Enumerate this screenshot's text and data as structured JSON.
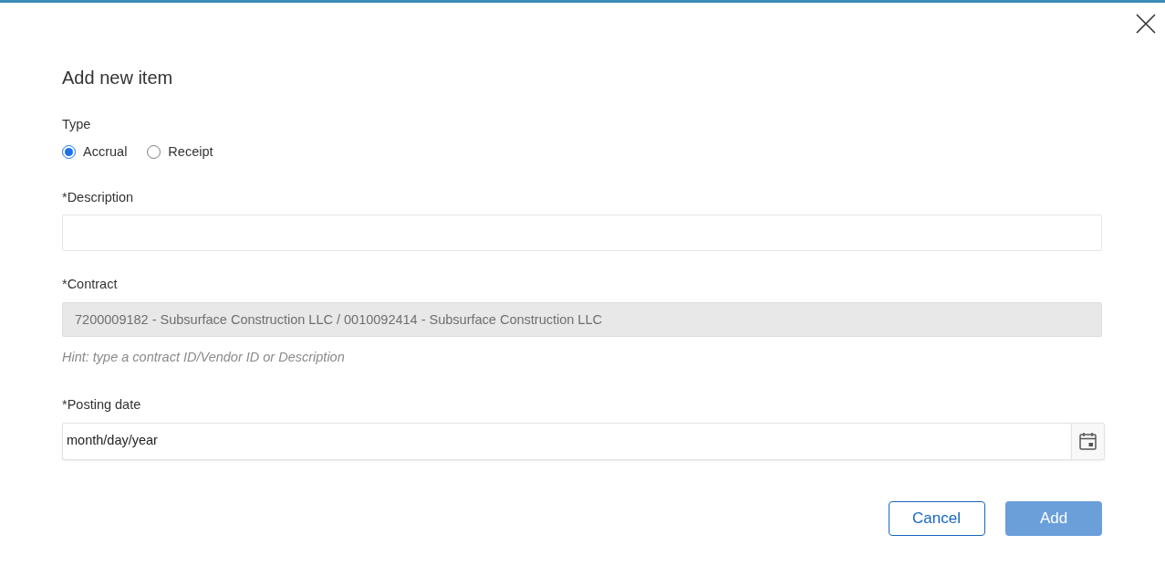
{
  "dialog": {
    "title": "Add new item"
  },
  "type_field": {
    "label": "Type",
    "options": [
      {
        "label": "Accrual",
        "selected": true
      },
      {
        "label": "Receipt",
        "selected": false
      }
    ]
  },
  "fields": [
    {
      "kind": "text",
      "label": "*Description",
      "disabled": false
    },
    {
      "kind": "text",
      "label": "*Contract",
      "value": "7200009182 - Subsurface Construction LLC / 0010092414 - Subsurface Construction LLC",
      "disabled": true,
      "hint": "Hint: type a contract ID/Vendor ID or Description"
    },
    {
      "kind": "date",
      "label": "*Posting date",
      "value": "month/day/year",
      "disabled": false
    }
  ],
  "buttons": [
    {
      "label": "Cancel",
      "kind": "secondary",
      "disabled": false
    },
    {
      "label": "Add",
      "kind": "primary",
      "disabled": true
    }
  ]
}
